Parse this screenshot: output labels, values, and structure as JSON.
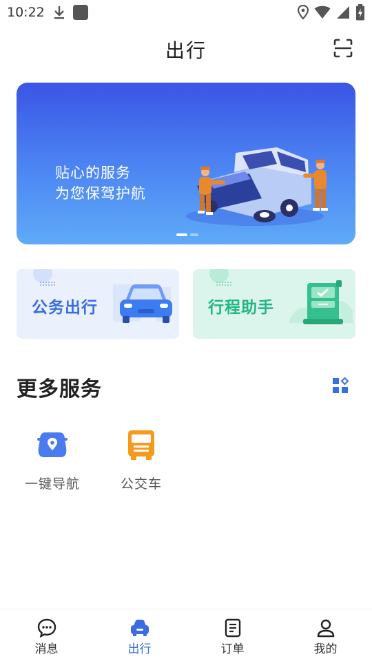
{
  "status_bar": {
    "time": "10:22",
    "left_icons": [
      "download-icon",
      "app-square-icon"
    ],
    "right_icons": [
      "location-icon",
      "wifi-icon",
      "signal-icon",
      "battery-icon"
    ]
  },
  "header": {
    "title": "出行",
    "scan_icon": "scan-icon"
  },
  "banner": {
    "line1": "贴心的服务",
    "line2": "为您保驾护航",
    "pages": 2,
    "active_page": 1
  },
  "cards": [
    {
      "label": "公务出行",
      "color": "#3a6ce3"
    },
    {
      "label": "行程助手",
      "color": "#22b585"
    }
  ],
  "more_services": {
    "title": "更多服务",
    "grid_icon": "grid-icon",
    "items": [
      {
        "label": "一键导航",
        "icon": "navigation-car-icon",
        "color": "#4a7cf0"
      },
      {
        "label": "公交车",
        "icon": "bus-icon",
        "color": "#f59a1b"
      }
    ]
  },
  "tab_bar": {
    "active": "出行",
    "tabs": [
      {
        "label": "消息",
        "icon": "message-icon"
      },
      {
        "label": "出行",
        "icon": "car-icon"
      },
      {
        "label": "订单",
        "icon": "order-icon"
      },
      {
        "label": "我的",
        "icon": "user-icon"
      }
    ]
  },
  "colors": {
    "accent": "#3a6ce3",
    "banner_top": "#3a55e6",
    "banner_bottom": "#5faaf8",
    "trip_green": "#22b585"
  }
}
